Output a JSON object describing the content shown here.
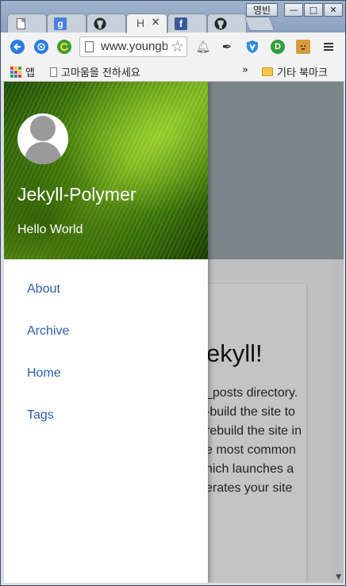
{
  "browser": {
    "user_badge": "영빈",
    "tabs": [
      {
        "icon": "blank-doc-icon"
      },
      {
        "icon": "google-icon",
        "glyph": "g"
      },
      {
        "icon": "github-icon"
      },
      {
        "label": "H",
        "active": true,
        "close": "×"
      },
      {
        "icon": "facebook-icon",
        "glyph": "f"
      },
      {
        "icon": "github-icon"
      }
    ],
    "window_controls": {
      "minimize": "—",
      "maximize": "□",
      "close": "✕"
    },
    "url": "www.youngbinkim.github.io",
    "bookmarks": {
      "apps_label": "앱",
      "item1": "고마움을 전하세요",
      "overflow": "»",
      "folder": "기타 북마크"
    }
  },
  "page": {
    "site_title": "Jekyll-Polymer",
    "site_subtitle": "Hello World",
    "nav": [
      "About",
      "Archive",
      "Home",
      "Tags"
    ],
    "post_heading_visible": "ekyll!",
    "post_lines_visible": [
      "_posts directory.",
      "-build the site to",
      " rebuild the site in",
      "e most common",
      "hich launches a",
      "erates your site"
    ]
  },
  "colors": {
    "link": "#2a5ea8",
    "header_gray": "#7b8688",
    "drawer_green": "#4f8f0c"
  }
}
